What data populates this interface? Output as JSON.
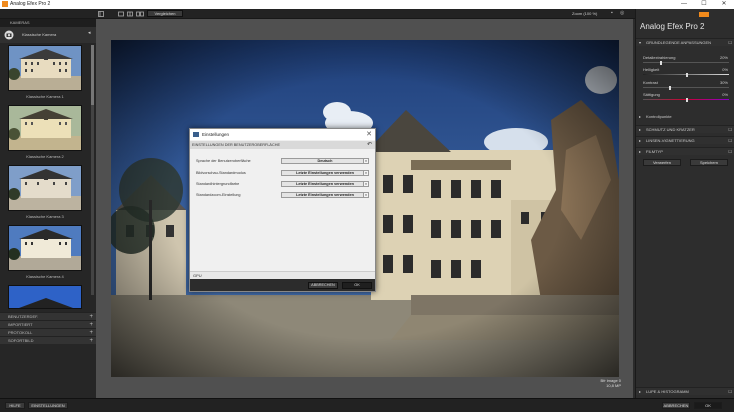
{
  "window": {
    "title": "Analog Efex Pro 2",
    "minimize": "—",
    "maximize": "☐",
    "close": "✕"
  },
  "toolbar": {
    "compare_label": "Vergleichen",
    "zoom_label": "Zoom (100 %)"
  },
  "sidebar": {
    "header": "KAMERAS",
    "category_label": "Klassische Kamera",
    "thumbnails": [
      {
        "label": "Klassische Kamera 1"
      },
      {
        "label": "Klassische Kamera 2"
      },
      {
        "label": "Klassische Kamera 3"
      },
      {
        "label": "Klassische Kamera 4"
      }
    ],
    "accordion": [
      "BENUTZERDEF.",
      "IMPORTIERT",
      "PROTOKOLL",
      "SOFORTBILD"
    ]
  },
  "image_info": {
    "name": "Bfr image 0",
    "size": "10,8 MP"
  },
  "right_panel": {
    "brand": "Analog Efex Pro",
    "version": "2",
    "section_basic": "GRUNDLEGENDE ANPASSUNGEN",
    "sliders": [
      {
        "label": "Detailextrahierung",
        "value_text": "20%",
        "value": 20
      },
      {
        "label": "Helligkeit",
        "value_text": "0%",
        "value": 0
      },
      {
        "label": "Kontrast",
        "value_text": "30%",
        "value": 30
      },
      {
        "label": "Sättigung",
        "value_text": "0%",
        "value": 0
      }
    ],
    "control_points": "Kontrollpunkte",
    "sections": [
      "SCHMUTZ UND KRATZER",
      "LINSEN-VIGNETTIERUNG",
      "FILMTYP"
    ],
    "discard_label": "Verwerfen",
    "save_label": "Speichern",
    "loupe_label": "LUPE & HISTOGRAMM"
  },
  "bottom": {
    "help_label": "HILFE",
    "settings_label": "EINSTELLUNGEN",
    "cancel_label": "ABBRECHEN",
    "ok_label": "OK"
  },
  "dialog": {
    "title": "Einstellungen",
    "section_header": "EINSTELLUNGEN DER BENUTZEROBERFLÄCHE",
    "rows": [
      {
        "label": "Sprache der Benutzeroberfläche",
        "value": "Deutsch"
      },
      {
        "label": "Bildvorschau-Standardmodus",
        "value": "Letzte Einstellungen verwenden"
      },
      {
        "label": "Standardhintergrundfarbe",
        "value": "Letzte Einstellungen verwenden"
      },
      {
        "label": "Standardzoom-Einstellung",
        "value": "Letzte Einstellungen verwenden"
      }
    ],
    "gpu_label": "GPU",
    "cancel_label": "ABBRECHEN",
    "ok_label": "OK"
  },
  "colors": {
    "accent": "#f18a1c",
    "panel": "#2d2d2d",
    "workspace": "#505050"
  }
}
